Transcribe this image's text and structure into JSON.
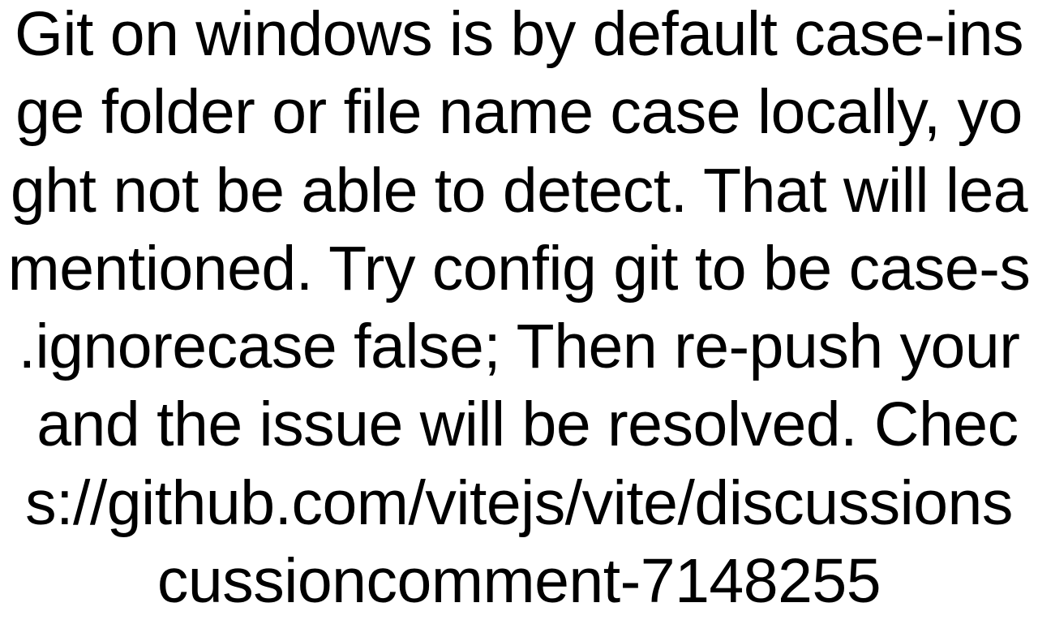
{
  "body": {
    "lines": [
      "Git on windows is by default case-ins",
      "ge folder or file name case locally, yo",
      "ght not be able to detect. That will lea",
      "mentioned. Try config git to be case-s",
      ".ignorecase false; Then re-push your",
      " and the issue will be resolved. Chec",
      "s://github.com/vitejs/vite/discussions",
      "cussioncomment-7148255"
    ]
  }
}
